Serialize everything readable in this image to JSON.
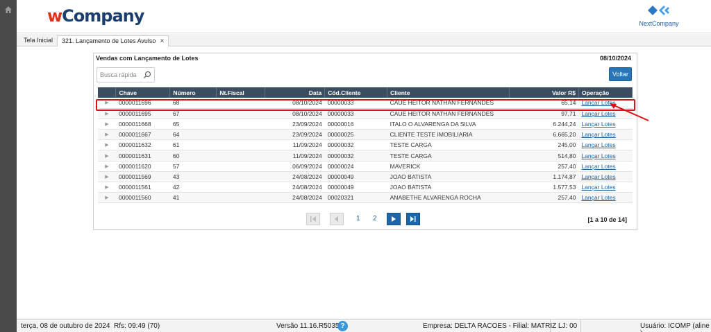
{
  "app": {
    "logo_prefix": "w",
    "logo_rest": "Company",
    "brand_right": "NextCompany",
    "colors": {
      "sidebar": "#4a4a4a",
      "header_table": "#3b4d61",
      "accent": "#2a75b5",
      "highlight": "#e01010",
      "link": "#1a5fa0"
    }
  },
  "tabs": [
    {
      "label": "Tela Inicial"
    },
    {
      "label": "321. Lançamento de Lotes Avulso",
      "close_icon": "close-icon"
    }
  ],
  "panel": {
    "title": "Vendas com Lançamento de Lotes",
    "date": "08/10/2024",
    "search_placeholder": "Busca rápida",
    "voltar_label": "Voltar"
  },
  "table": {
    "columns": [
      "Chave",
      "Número",
      "Nt.Fiscal",
      "Data",
      "Cód.Cliente",
      "Cliente",
      "Valor R$",
      "Operação"
    ],
    "rows": [
      {
        "chave": "0000011696",
        "numero": "68",
        "nf": "",
        "data": "08/10/2024",
        "cod": "00000033",
        "cliente": "CAUE HEITOR NATHAN FERNANDES",
        "valor": "65,14",
        "op": "Lançar Lotes"
      },
      {
        "chave": "0000011695",
        "numero": "67",
        "nf": "",
        "data": "08/10/2024",
        "cod": "00000033",
        "cliente": "CAUE HEITOR NATHAN FERNANDES",
        "valor": "97,71",
        "op": "Lançar Lotes"
      },
      {
        "chave": "0000011668",
        "numero": "65",
        "nf": "",
        "data": "23/09/2024",
        "cod": "00000016",
        "cliente": "ITALO O ALVARENGA DA SILVA",
        "valor": "6.244,24",
        "op": "Lançar Lotes"
      },
      {
        "chave": "0000011667",
        "numero": "64",
        "nf": "",
        "data": "23/09/2024",
        "cod": "00000025",
        "cliente": "CLIENTE TESTE IMOBILIARIA",
        "valor": "6.665,20",
        "op": "Lançar Lotes"
      },
      {
        "chave": "0000011632",
        "numero": "61",
        "nf": "",
        "data": "11/09/2024",
        "cod": "00000032",
        "cliente": "TESTE CARGA",
        "valor": "245,00",
        "op": "Lançar Lotes"
      },
      {
        "chave": "0000011631",
        "numero": "60",
        "nf": "",
        "data": "11/09/2024",
        "cod": "00000032",
        "cliente": "TESTE CARGA",
        "valor": "514,80",
        "op": "Lançar Lotes"
      },
      {
        "chave": "0000011620",
        "numero": "57",
        "nf": "",
        "data": "06/09/2024",
        "cod": "00000024",
        "cliente": "MAVERICK",
        "valor": "257,40",
        "op": "Lançar Lotes"
      },
      {
        "chave": "0000011569",
        "numero": "43",
        "nf": "",
        "data": "24/08/2024",
        "cod": "00000049",
        "cliente": "JOAO BATISTA",
        "valor": "1.174,87",
        "op": "Lançar Lotes"
      },
      {
        "chave": "0000011561",
        "numero": "42",
        "nf": "",
        "data": "24/08/2024",
        "cod": "00000049",
        "cliente": "JOAO BATISTA",
        "valor": "1.577,53",
        "op": "Lançar Lotes"
      },
      {
        "chave": "0000011560",
        "numero": "41",
        "nf": "",
        "data": "24/08/2024",
        "cod": "00020321",
        "cliente": "ANABETHE ALVARENGA ROCHA",
        "valor": "257,40",
        "op": "Lançar Lotes"
      }
    ]
  },
  "pager": {
    "pages": [
      "1",
      "2"
    ],
    "range": "[1 a 10 de 14]"
  },
  "status": {
    "date": "terça, 08 de outubro de 2024",
    "rfs": "Rfs: 09:49 (70)",
    "version": "Versão 11.16.R5035",
    "help": "?",
    "empresa": "Empresa: DELTA RACOES - Filial: MATRIZ",
    "lj": "LJ: 00",
    "usuario": "Usuário: ICOMP (aline )"
  }
}
